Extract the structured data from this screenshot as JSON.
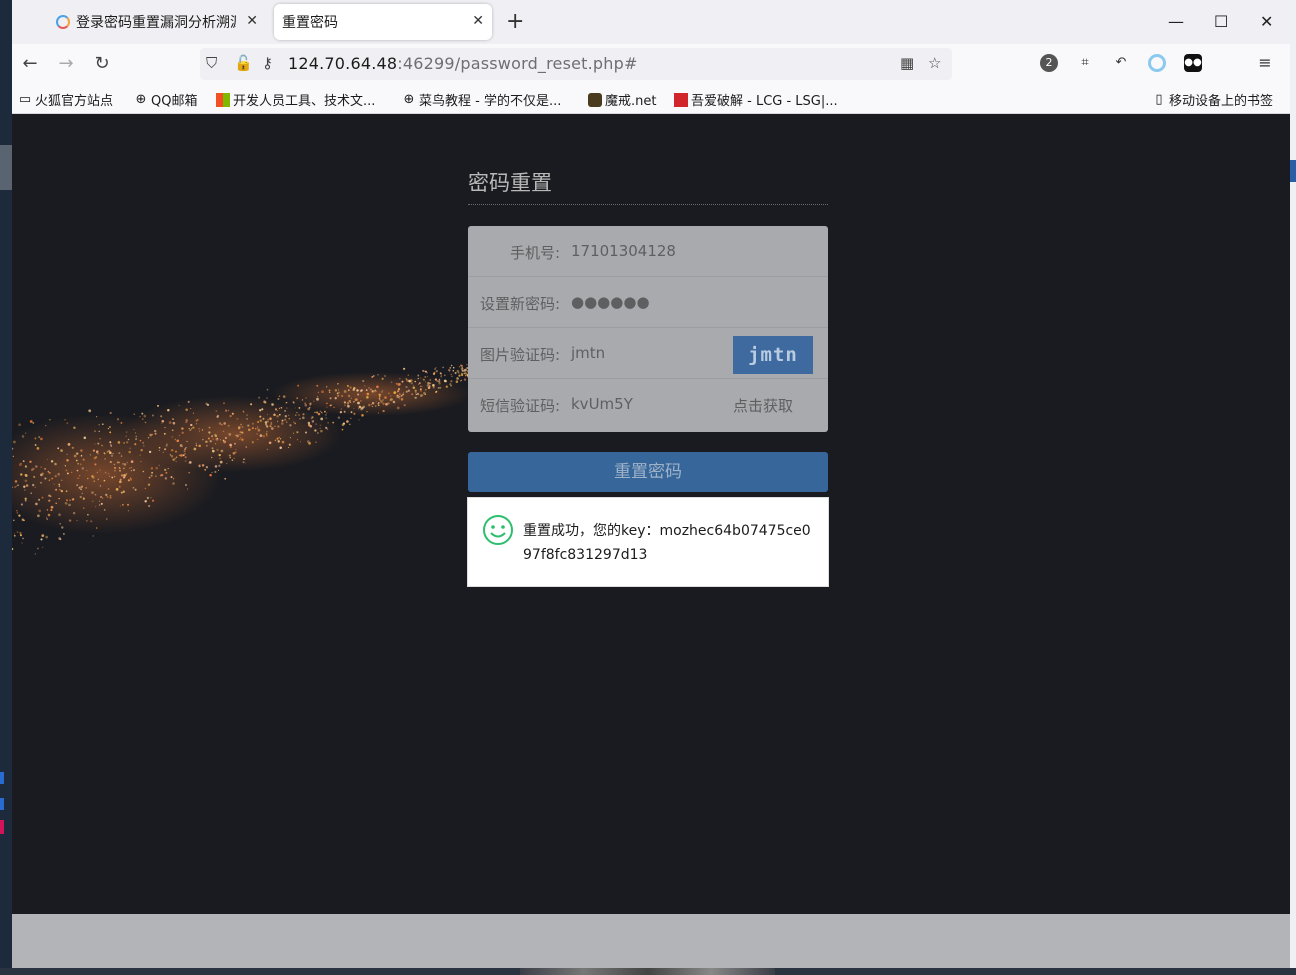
{
  "browser": {
    "tabs": [
      {
        "title": "登录密码重置漏洞分析溯源",
        "active": false
      },
      {
        "title": "重置密码",
        "active": true
      }
    ],
    "new_tab": "+",
    "window_controls": {
      "minimize": "—",
      "maximize": "☐",
      "close": "✕"
    },
    "url": {
      "host": "124.70.64.48",
      "rest": ":46299/password_reset.php#"
    },
    "extension_badge": "2",
    "bookmarks": [
      "火狐官方站点",
      "QQ邮箱",
      "开发人员工具、技术文...",
      "菜鸟教程 - 学的不仅是...",
      "魔戒.net",
      "吾爱破解 - LCG - LSG|...",
      "移动设备上的书签"
    ]
  },
  "page": {
    "title": "密码重置",
    "fields": {
      "phone": {
        "label": "手机号:",
        "value": "17101304128"
      },
      "new_password": {
        "label": "设置新密码:",
        "value": "●●●●●●"
      },
      "image_code": {
        "label": "图片验证码:",
        "value": "jmtn",
        "captcha": "jmtn"
      },
      "sms_code": {
        "label": "短信验证码:",
        "value": "kvUm5Y",
        "action": "点击获取"
      }
    },
    "submit": "重置密码",
    "toast": "重置成功，您的key：mozhec64b07475ce097f8fc831297d13"
  },
  "colors": {
    "content_bg": "#1a1b20",
    "button": "#37679a",
    "form_bg": "#a9aaad",
    "toast_icon": "#2bbf6d"
  }
}
